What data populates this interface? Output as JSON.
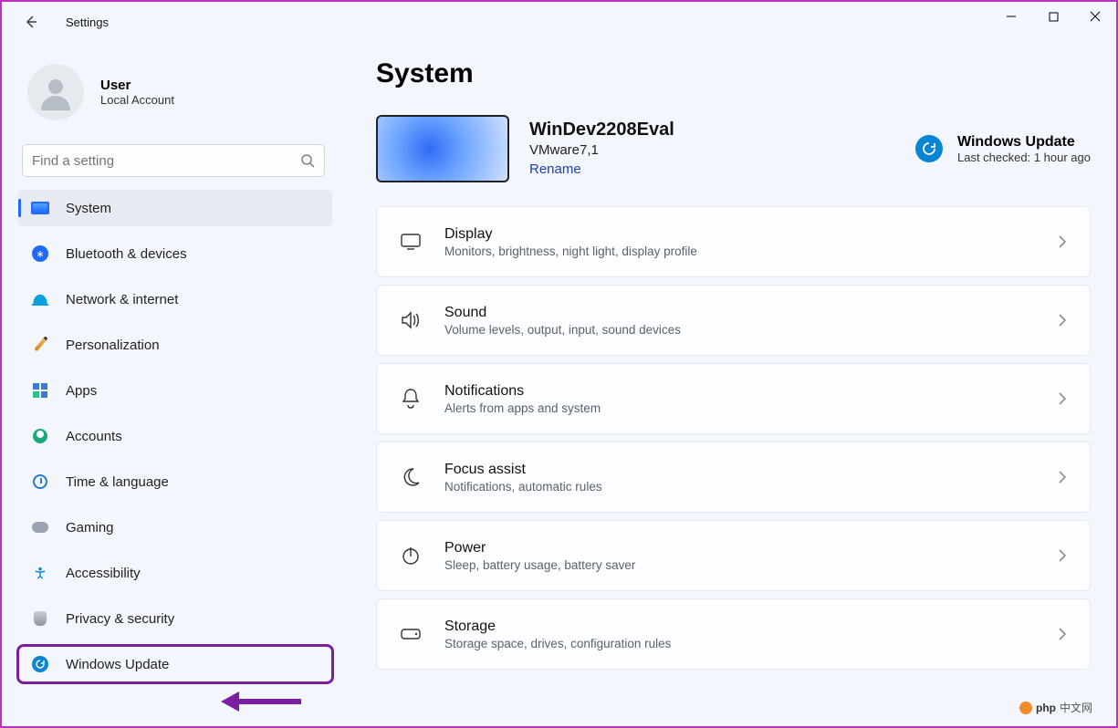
{
  "window": {
    "title": "Settings"
  },
  "colors": {
    "accent": "#1f69ff",
    "highlight": "#7a1fa2"
  },
  "user": {
    "name": "User",
    "sub": "Local Account"
  },
  "search": {
    "placeholder": "Find a setting"
  },
  "sidebar": {
    "items": [
      {
        "label": "System"
      },
      {
        "label": "Bluetooth & devices"
      },
      {
        "label": "Network & internet"
      },
      {
        "label": "Personalization"
      },
      {
        "label": "Apps"
      },
      {
        "label": "Accounts"
      },
      {
        "label": "Time & language"
      },
      {
        "label": "Gaming"
      },
      {
        "label": "Accessibility"
      },
      {
        "label": "Privacy & security"
      },
      {
        "label": "Windows Update"
      }
    ]
  },
  "main": {
    "heading": "System",
    "pc": {
      "name": "WinDev2208Eval",
      "model": "VMware7,1",
      "rename": "Rename"
    },
    "update": {
      "title": "Windows Update",
      "sub": "Last checked: 1 hour ago"
    },
    "items": [
      {
        "title": "Display",
        "sub": "Monitors, brightness, night light, display profile"
      },
      {
        "title": "Sound",
        "sub": "Volume levels, output, input, sound devices"
      },
      {
        "title": "Notifications",
        "sub": "Alerts from apps and system"
      },
      {
        "title": "Focus assist",
        "sub": "Notifications, automatic rules"
      },
      {
        "title": "Power",
        "sub": "Sleep, battery usage, battery saver"
      },
      {
        "title": "Storage",
        "sub": "Storage space, drives, configuration rules"
      }
    ]
  },
  "watermark": "中文网"
}
